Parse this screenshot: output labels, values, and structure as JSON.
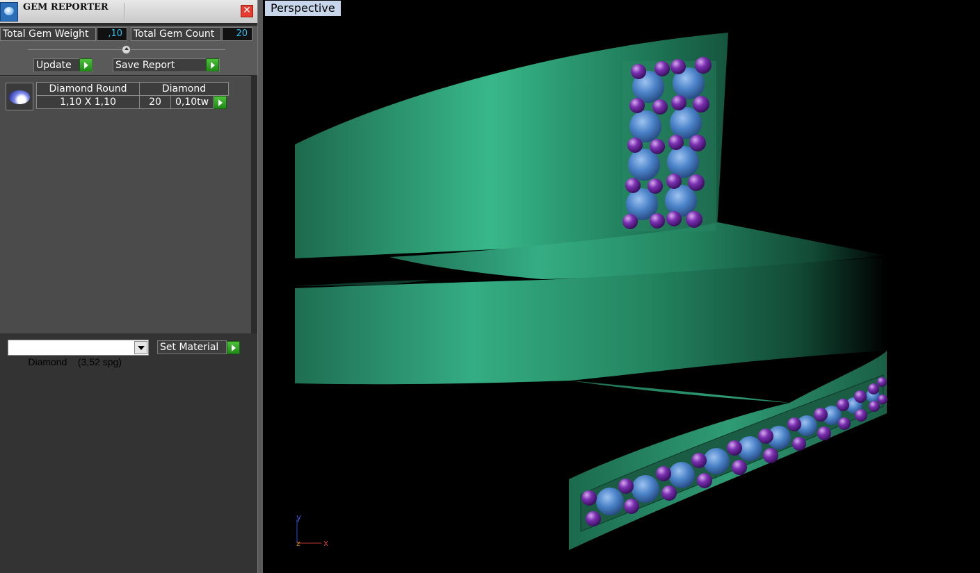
{
  "panel": {
    "title": "GEM REPORTER",
    "close_glyph": "✕",
    "totals": {
      "weight_label": "Total Gem Weight",
      "weight_value": ",10",
      "count_label": "Total Gem Count",
      "count_value": "20"
    },
    "buttons": {
      "update_label": "Update",
      "save_report_label": "Save Report",
      "set_material_label": "Set Material"
    },
    "gem_list": [
      {
        "shape": "Diamond Round",
        "material": "Diamond",
        "size": "1,10 X 1,10",
        "count": "20",
        "weight": "0,10tw"
      }
    ],
    "material_select": {
      "selected": "Diamond    (3,52 spg)"
    }
  },
  "viewport": {
    "label": "Perspective",
    "axis_labels": {
      "y": "y",
      "z": "z",
      "x": "x"
    }
  },
  "icons": [
    "gem-reporter-app-icon",
    "close-icon",
    "play-arrow-icon",
    "diamond-thumbnail-icon",
    "chevron-down-icon",
    "axis-gizmo-icon"
  ],
  "colors": {
    "band_green": "#2a8a66",
    "gem_blue": "#4a82c8",
    "prong_purple": "#6a2a9a",
    "value_cyan": "#32c0f0",
    "close_red": "#e63b2e",
    "play_green": "#2ca021",
    "view_label_bg": "#c7d6ea"
  }
}
